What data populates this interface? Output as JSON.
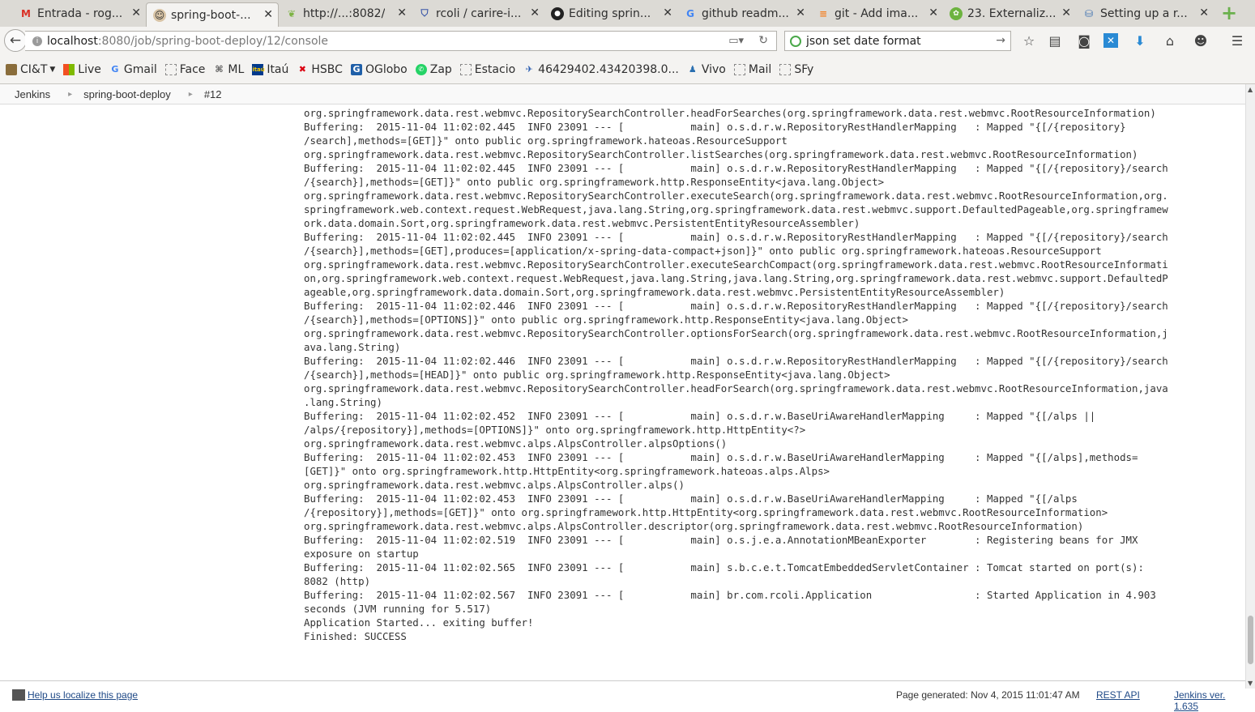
{
  "tabs": [
    {
      "label": "Entrada - rog...",
      "icon": "gmail-icon",
      "active": false
    },
    {
      "label": "spring-boot-...",
      "icon": "jenkins-icon",
      "active": true
    },
    {
      "label": "http://...:8082/",
      "icon": "leaf-icon",
      "active": false
    },
    {
      "label": "rcoli / carire-i...",
      "icon": "shield-icon",
      "active": false
    },
    {
      "label": "Editing sprin...",
      "icon": "github-icon",
      "active": false
    },
    {
      "label": "github readm...",
      "icon": "google-icon",
      "active": false
    },
    {
      "label": "git - Add ima...",
      "icon": "stackoverflow-icon",
      "active": false
    },
    {
      "label": "23. Externaliz...",
      "icon": "spring-icon",
      "active": false
    },
    {
      "label": "Setting up a r...",
      "icon": "database-icon",
      "active": false
    }
  ],
  "nav": {
    "url_host": "localhost",
    "url_path": ":8080/job/spring-boot-deploy/12/console",
    "search_value": "json set date format"
  },
  "bookmarks": [
    {
      "label": "CI&T",
      "icon": "folder-icon",
      "dropdown": true
    },
    {
      "label": "Live",
      "icon": "windows-icon"
    },
    {
      "label": "Gmail",
      "icon": "google-icon"
    },
    {
      "label": "Face",
      "icon": "page-icon"
    },
    {
      "label": "ML",
      "icon": "ml-icon"
    },
    {
      "label": "Itaú",
      "icon": "itau-icon"
    },
    {
      "label": "HSBC",
      "icon": "hsbc-icon"
    },
    {
      "label": "OGlobo",
      "icon": "oglobo-icon"
    },
    {
      "label": "Zap",
      "icon": "whatsapp-icon"
    },
    {
      "label": "Estacio",
      "icon": "page-icon"
    },
    {
      "label": "46429402.43420398.0...",
      "icon": "link-icon"
    },
    {
      "label": "Vivo",
      "icon": "vivo-icon"
    },
    {
      "label": "Mail",
      "icon": "page-icon"
    },
    {
      "label": "SFy",
      "icon": "page-icon"
    }
  ],
  "breadcrumbs": [
    "Jenkins",
    "spring-boot-deploy",
    "#12"
  ],
  "console_lines": [
    "org.springframework.data.rest.webmvc.RepositorySearchController.headForSearches(org.springframework.data.rest.webmvc.RootResourceInformation)",
    "Buffering:  2015-11-04 11:02:02.445  INFO 23091 --- [           main] o.s.d.r.w.RepositoryRestHandlerMapping   : Mapped \"{[/{repository}",
    "/search],methods=[GET]}\" onto public org.springframework.hateoas.ResourceSupport",
    "org.springframework.data.rest.webmvc.RepositorySearchController.listSearches(org.springframework.data.rest.webmvc.RootResourceInformation)",
    "Buffering:  2015-11-04 11:02:02.445  INFO 23091 --- [           main] o.s.d.r.w.RepositoryRestHandlerMapping   : Mapped \"{[/{repository}/search",
    "/{search}],methods=[GET]}\" onto public org.springframework.http.ResponseEntity<java.lang.Object>",
    "org.springframework.data.rest.webmvc.RepositorySearchController.executeSearch(org.springframework.data.rest.webmvc.RootResourceInformation,org.",
    "springframework.web.context.request.WebRequest,java.lang.String,org.springframework.data.rest.webmvc.support.DefaultedPageable,org.springframew",
    "ork.data.domain.Sort,org.springframework.data.rest.webmvc.PersistentEntityResourceAssembler)",
    "Buffering:  2015-11-04 11:02:02.445  INFO 23091 --- [           main] o.s.d.r.w.RepositoryRestHandlerMapping   : Mapped \"{[/{repository}/search",
    "/{search}],methods=[GET],produces=[application/x-spring-data-compact+json]}\" onto public org.springframework.hateoas.ResourceSupport",
    "org.springframework.data.rest.webmvc.RepositorySearchController.executeSearchCompact(org.springframework.data.rest.webmvc.RootResourceInformati",
    "on,org.springframework.web.context.request.WebRequest,java.lang.String,java.lang.String,org.springframework.data.rest.webmvc.support.DefaultedP",
    "ageable,org.springframework.data.domain.Sort,org.springframework.data.rest.webmvc.PersistentEntityResourceAssembler)",
    "Buffering:  2015-11-04 11:02:02.446  INFO 23091 --- [           main] o.s.d.r.w.RepositoryRestHandlerMapping   : Mapped \"{[/{repository}/search",
    "/{search}],methods=[OPTIONS]}\" onto public org.springframework.http.ResponseEntity<java.lang.Object>",
    "org.springframework.data.rest.webmvc.RepositorySearchController.optionsForSearch(org.springframework.data.rest.webmvc.RootResourceInformation,j",
    "ava.lang.String)",
    "Buffering:  2015-11-04 11:02:02.446  INFO 23091 --- [           main] o.s.d.r.w.RepositoryRestHandlerMapping   : Mapped \"{[/{repository}/search",
    "/{search}],methods=[HEAD]}\" onto public org.springframework.http.ResponseEntity<java.lang.Object>",
    "org.springframework.data.rest.webmvc.RepositorySearchController.headForSearch(org.springframework.data.rest.webmvc.RootResourceInformation,java",
    ".lang.String)",
    "Buffering:  2015-11-04 11:02:02.452  INFO 23091 --- [           main] o.s.d.r.w.BaseUriAwareHandlerMapping     : Mapped \"{[/alps ||",
    "/alps/{repository}],methods=[OPTIONS]}\" onto org.springframework.http.HttpEntity<?>",
    "org.springframework.data.rest.webmvc.alps.AlpsController.alpsOptions()",
    "Buffering:  2015-11-04 11:02:02.453  INFO 23091 --- [           main] o.s.d.r.w.BaseUriAwareHandlerMapping     : Mapped \"{[/alps],methods=",
    "[GET]}\" onto org.springframework.http.HttpEntity<org.springframework.hateoas.alps.Alps>",
    "org.springframework.data.rest.webmvc.alps.AlpsController.alps()",
    "Buffering:  2015-11-04 11:02:02.453  INFO 23091 --- [           main] o.s.d.r.w.BaseUriAwareHandlerMapping     : Mapped \"{[/alps",
    "/{repository}],methods=[GET]}\" onto org.springframework.http.HttpEntity<org.springframework.data.rest.webmvc.RootResourceInformation>",
    "org.springframework.data.rest.webmvc.alps.AlpsController.descriptor(org.springframework.data.rest.webmvc.RootResourceInformation)",
    "Buffering:  2015-11-04 11:02:02.519  INFO 23091 --- [           main] o.s.j.e.a.AnnotationMBeanExporter        : Registering beans for JMX",
    "exposure on startup",
    "Buffering:  2015-11-04 11:02:02.565  INFO 23091 --- [           main] s.b.c.e.t.TomcatEmbeddedServletContainer : Tomcat started on port(s):",
    "8082 (http)",
    "Buffering:  2015-11-04 11:02:02.567  INFO 23091 --- [           main] br.com.rcoli.Application                 : Started Application in 4.903",
    "seconds (JVM running for 5.517)",
    "Application Started... exiting buffer!",
    "Finished: SUCCESS"
  ],
  "footer": {
    "help_link": "Help us localize this page",
    "generated": "Page generated: Nov 4, 2015 11:01:47 AM",
    "rest_api": "REST API",
    "version": "Jenkins ver. 1.635"
  }
}
